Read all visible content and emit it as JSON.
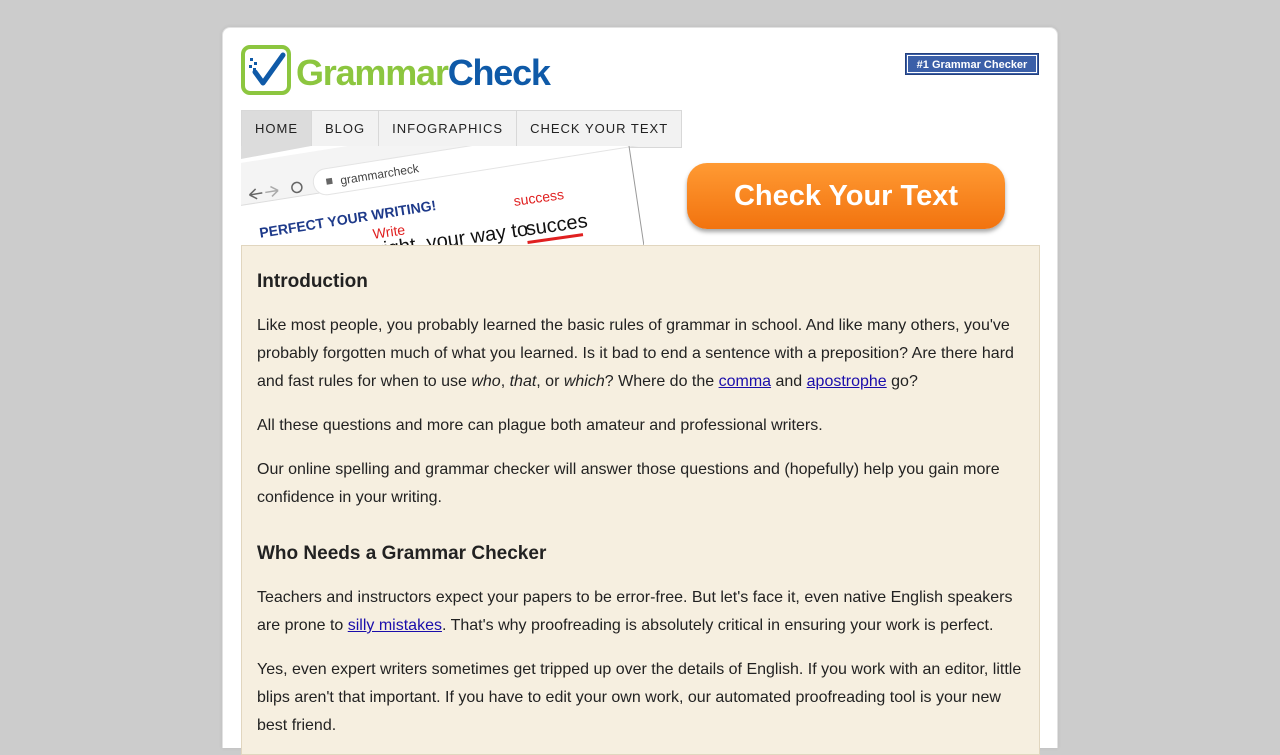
{
  "logo": {
    "text_part1": "Grammar",
    "text_part2": "Check",
    "icon": "checkmark-logo-icon"
  },
  "badge": {
    "label": "#1 Grammar Checker"
  },
  "nav": {
    "items": [
      {
        "label": "HOME"
      },
      {
        "label": "BLOG"
      },
      {
        "label": "INFOGRAPHICS"
      },
      {
        "label": "CHECK YOUR TEXT"
      }
    ]
  },
  "banner": {
    "url": "grammarcheck",
    "headline": "PERFECT YOUR WRITING!",
    "correction1": "Write",
    "correction2": "success",
    "line_word1": "right",
    "line_middle": "your way to",
    "line_word2": "succes"
  },
  "cta": {
    "label": "Check Your Text"
  },
  "content": {
    "intro_heading": "Introduction",
    "p1": {
      "t1": "Like most people, you probably learned the basic rules of grammar in school. And like many others, you've probably forgotten much of what you learned. Is it bad to end a sentence with a preposition? Are there hard and fast rules for when to use ",
      "who": "who",
      "sep1": ", ",
      "that": "that",
      "sep2": ", or ",
      "which": "which",
      "t2": "? Where do the ",
      "comma_link": "comma",
      "t3": " and ",
      "apostrophe_link": "apostrophe",
      "t4": " go?"
    },
    "p2": "All these questions and more can plague both amateur and professional writers.",
    "p3": "Our online spelling and grammar checker will answer those questions and (hopefully) help you gain more confidence in your writing.",
    "who_heading": "Who Needs a Grammar Checker",
    "p4": {
      "t1": "Teachers and instructors expect your papers to be error-free. But let's face it, even native English speakers are prone to ",
      "link": "silly mistakes",
      "t2": ". That's why proofreading is absolutely critical in ensuring your work is perfect."
    },
    "p5": "Yes, even expert writers sometimes get tripped up over the details of English. If you work with an editor, little blips aren't that important. If you have to edit your own work, our automated proofreading tool is your new best friend."
  },
  "colors": {
    "logo_green": "#8cc63f",
    "logo_blue": "#0f5aa8",
    "badge_bg": "#3b5fa8",
    "cta_orange": "#f2730f",
    "content_bg": "#f6efe0",
    "link": "#1a0dab"
  }
}
